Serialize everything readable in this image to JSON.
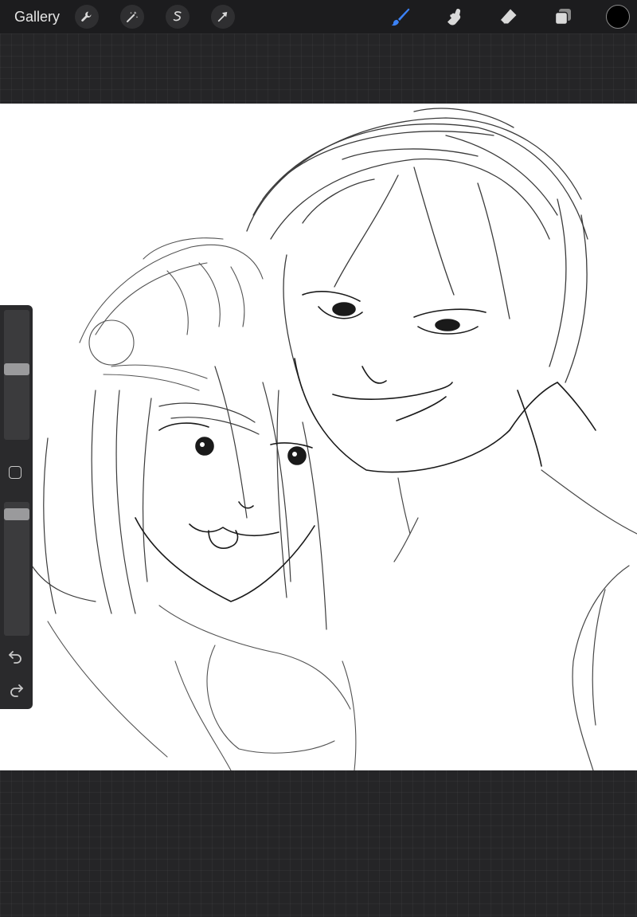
{
  "topbar": {
    "gallery_label": "Gallery",
    "left_tools": [
      {
        "name": "actions",
        "icon": "wrench-icon"
      },
      {
        "name": "adjustments",
        "icon": "magic-wand-icon"
      },
      {
        "name": "selection",
        "icon": "selection-s-icon"
      },
      {
        "name": "transform",
        "icon": "arrow-cursor-icon"
      }
    ],
    "right_tools": [
      {
        "name": "brush",
        "icon": "brush-icon",
        "active": true
      },
      {
        "name": "smudge",
        "icon": "smudge-finger-icon",
        "active": false
      },
      {
        "name": "eraser",
        "icon": "eraser-icon",
        "active": false
      },
      {
        "name": "layers",
        "icon": "layers-icon",
        "active": false
      }
    ],
    "current_color": "#000000"
  },
  "sidebar": {
    "brush_size_level": 0.55,
    "opacity_level": 0.95,
    "modify_icon": "square-icon",
    "undo_icon": "undo-arrow-icon",
    "redo_icon": "redo-arrow-icon"
  },
  "colors": {
    "active_tool": "#3b82f6",
    "inactive_tool": "#d9d9d9",
    "canvas": "#ffffff",
    "stroke": "#1a1a1a"
  }
}
